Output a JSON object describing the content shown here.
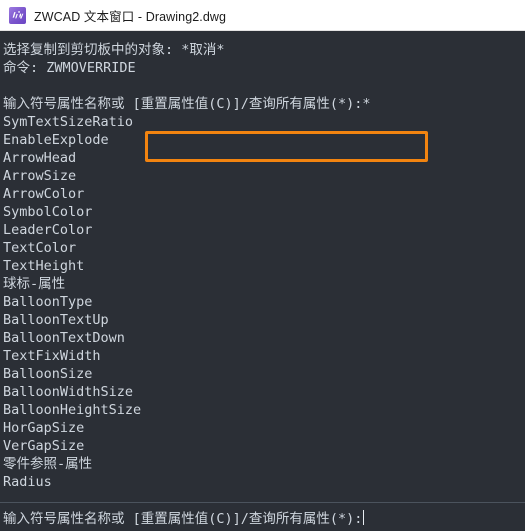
{
  "window": {
    "icon_name": "zwcad-app-icon",
    "title": "ZWCAD 文本窗口 - Drawing2.dwg",
    "accent_orange": "#f28410",
    "console_bg": "#2b2f36",
    "console_fg": "#cfd6de",
    "titlebar_bg": "#ffffff"
  },
  "console": {
    "history": [
      "选择复制到剪切板中的对象: *取消*",
      "命令: ZWMOVERRIDE",
      ""
    ],
    "prompt_highlighted": {
      "label": "输入符号属性名称或 ",
      "options": "[重置属性值(C)]/查询所有属性(*):*"
    },
    "attribute_list": [
      "SymTextSizeRatio",
      "EnableExplode",
      "ArrowHead",
      "ArrowSize",
      "ArrowColor",
      "SymbolColor",
      "LeaderColor",
      "TextColor",
      "TextHeight",
      "球标-属性",
      "BalloonType",
      "BalloonTextUp",
      "BalloonTextDown",
      "TextFixWidth",
      "BalloonSize",
      "BalloonWidthSize",
      "BalloonHeightSize",
      "HorGapSize",
      "VerGapSize",
      "零件参照-属性",
      "Radius"
    ]
  },
  "command_input": {
    "prompt": "输入符号属性名称或 [重置属性值(C)]/查询所有属性(*):",
    "value": ""
  }
}
